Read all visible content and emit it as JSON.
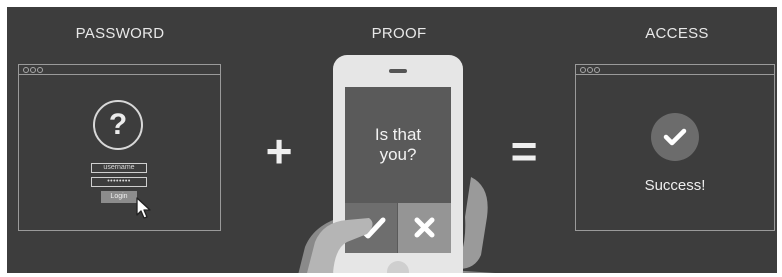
{
  "headings": {
    "password": "PASSWORD",
    "proof": "PROOF",
    "access": "ACCESS"
  },
  "login_window": {
    "question_mark": "?",
    "username_field": "username",
    "password_field": "••••••••",
    "login_button": "Login"
  },
  "operators": {
    "plus": "+",
    "equals": "="
  },
  "phone": {
    "prompt_line1": "Is that",
    "prompt_line2": "you?"
  },
  "access_window": {
    "message": "Success!"
  },
  "colors": {
    "background": "#3d3d3d",
    "foreground": "#e8e8e8",
    "phone_body": "#e6e6e6",
    "phone_screen": "#5a5a5a"
  },
  "icons": [
    "question-mark-icon",
    "cursor-arrow-icon",
    "check-icon",
    "cross-icon",
    "success-check-icon"
  ]
}
